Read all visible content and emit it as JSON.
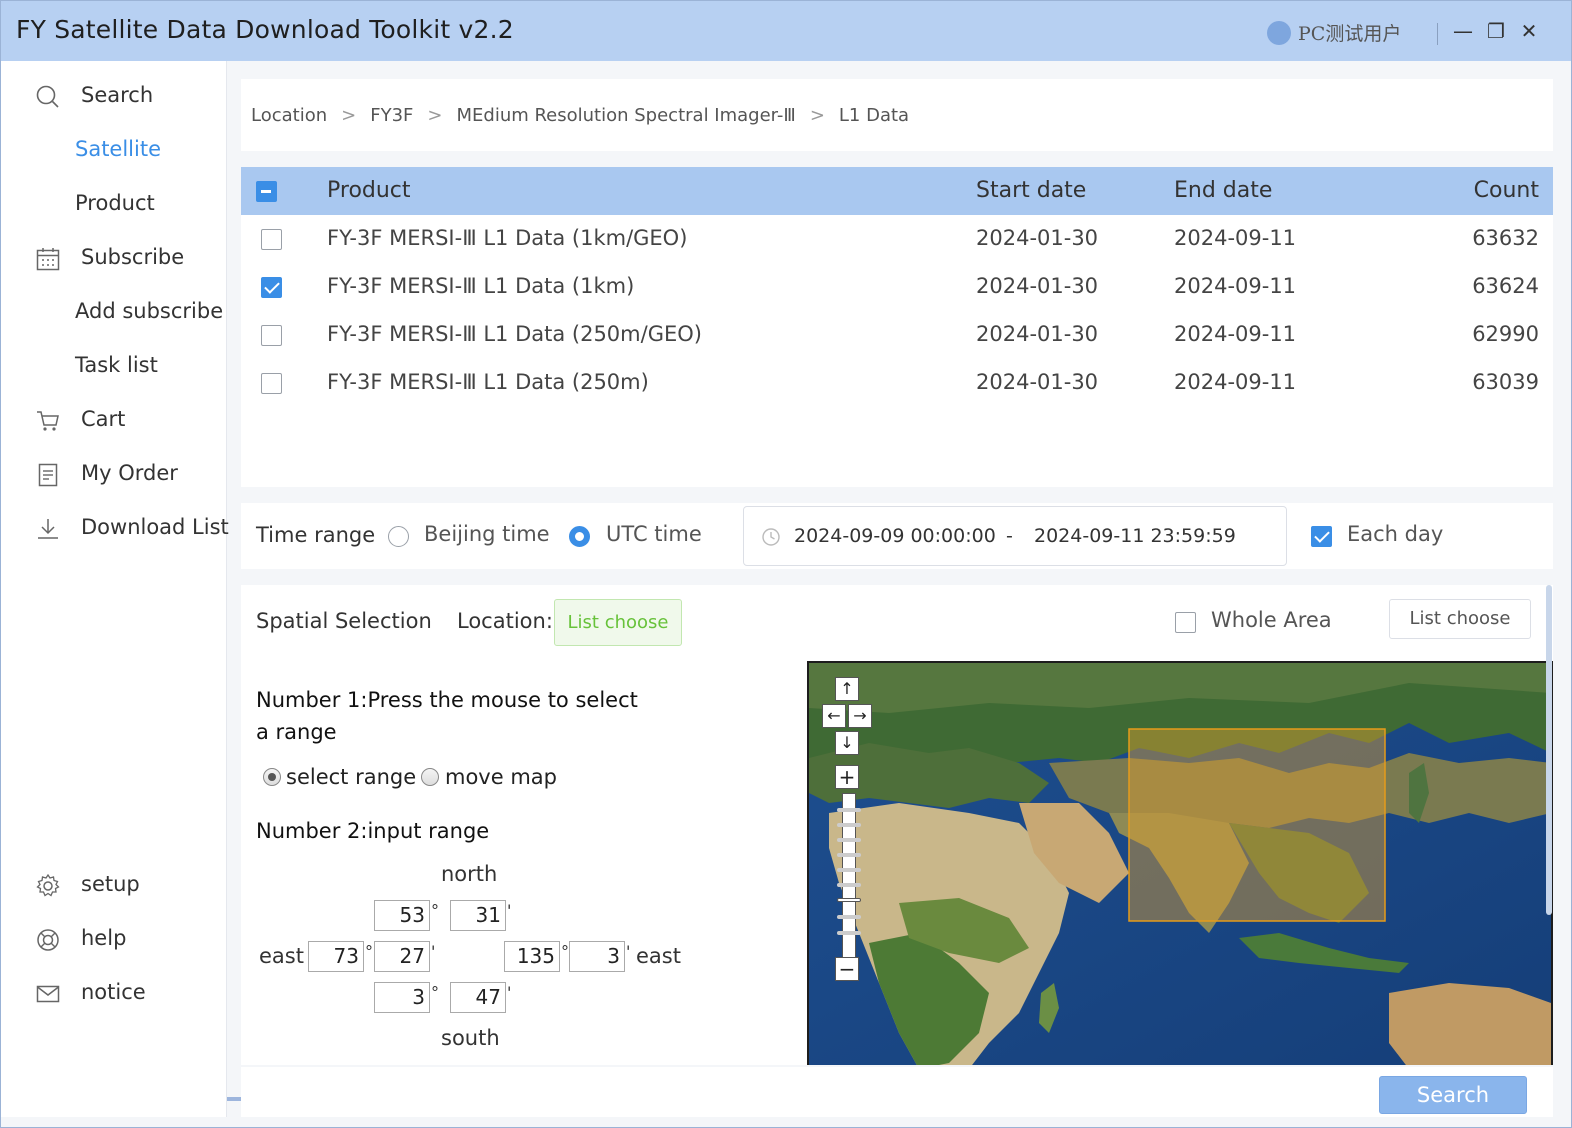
{
  "app": {
    "title": "FY Satellite Data Download Toolkit v2.2",
    "user": "PC测试用户",
    "window_controls": {
      "minimize": "—",
      "maximize": "❐",
      "close": "✕"
    }
  },
  "sidebar": {
    "items": [
      {
        "label": "Search",
        "icon": "search-icon",
        "sub": false,
        "active": false
      },
      {
        "label": "Satellite",
        "icon": "",
        "sub": true,
        "active": true
      },
      {
        "label": "Product",
        "icon": "",
        "sub": true,
        "active": false
      },
      {
        "label": "Subscribe",
        "icon": "calendar-icon",
        "sub": false,
        "active": false
      },
      {
        "label": "Add subscribe",
        "icon": "",
        "sub": true,
        "active": false
      },
      {
        "label": "Task list",
        "icon": "",
        "sub": true,
        "active": false
      },
      {
        "label": "Cart",
        "icon": "cart-icon",
        "sub": false,
        "active": false
      },
      {
        "label": "My Order",
        "icon": "document-icon",
        "sub": false,
        "active": false
      },
      {
        "label": "Download List",
        "icon": "download-icon",
        "sub": false,
        "active": false
      }
    ],
    "bottom_items": [
      {
        "label": "setup",
        "icon": "gear-icon"
      },
      {
        "label": "help",
        "icon": "lifebuoy-icon"
      },
      {
        "label": "notice",
        "icon": "mail-icon"
      }
    ]
  },
  "breadcrumb": {
    "items": [
      "Location",
      "FY3F",
      "MEdium Resolution Spectral Imager-Ⅲ",
      "L1 Data"
    ],
    "separator": ">"
  },
  "table": {
    "headers": {
      "product": "Product",
      "start": "Start date",
      "end": "End date",
      "count": "Count"
    },
    "rows": [
      {
        "product": "FY-3F MERSI-Ⅲ L1 Data (1km/GEO)",
        "start": "2024-01-30",
        "end": "2024-09-11",
        "count": "63632",
        "checked": false
      },
      {
        "product": "FY-3F MERSI-Ⅲ L1 Data (1km)",
        "start": "2024-01-30",
        "end": "2024-09-11",
        "count": "63624",
        "checked": true
      },
      {
        "product": "FY-3F MERSI-Ⅲ L1 Data (250m/GEO)",
        "start": "2024-01-30",
        "end": "2024-09-11",
        "count": "62990",
        "checked": false
      },
      {
        "product": "FY-3F MERSI-Ⅲ L1 Data (250m)",
        "start": "2024-01-30",
        "end": "2024-09-11",
        "count": "63039",
        "checked": false
      }
    ]
  },
  "time": {
    "label": "Time range",
    "beijing": "Beijing time",
    "utc": "UTC time",
    "selected": "utc",
    "start": "2024-09-09 00:00:00",
    "dash": "-",
    "end": "2024-09-11 23:59:59",
    "each_day": "Each day",
    "each_day_checked": true
  },
  "spatial": {
    "title": "Spatial Selection",
    "location_label": "Location:",
    "list_choose_green": "List choose",
    "whole_area": "Whole Area",
    "list_choose": "List choose",
    "step1": "Number 1:Press the mouse to select a range",
    "select_range": "select range",
    "move_map": "move map",
    "step2": "Number 2:input range",
    "north_label": "north",
    "south_label": "south",
    "west_label": "east",
    "east_label": "east",
    "north": {
      "deg": "53",
      "min": "31"
    },
    "west": {
      "deg": "73",
      "min": "27"
    },
    "east": {
      "deg": "135",
      "min": "3"
    },
    "south": {
      "deg": "3",
      "min": "47"
    },
    "deg_sym": "°",
    "min_sym": "'"
  },
  "map": {
    "pan_up": "↑",
    "pan_left": "←",
    "pan_right": "→",
    "pan_down": "↓",
    "zoom_in": "+",
    "zoom_out": "−",
    "selection_color": "#e0a030"
  },
  "footer": {
    "search": "Search"
  }
}
